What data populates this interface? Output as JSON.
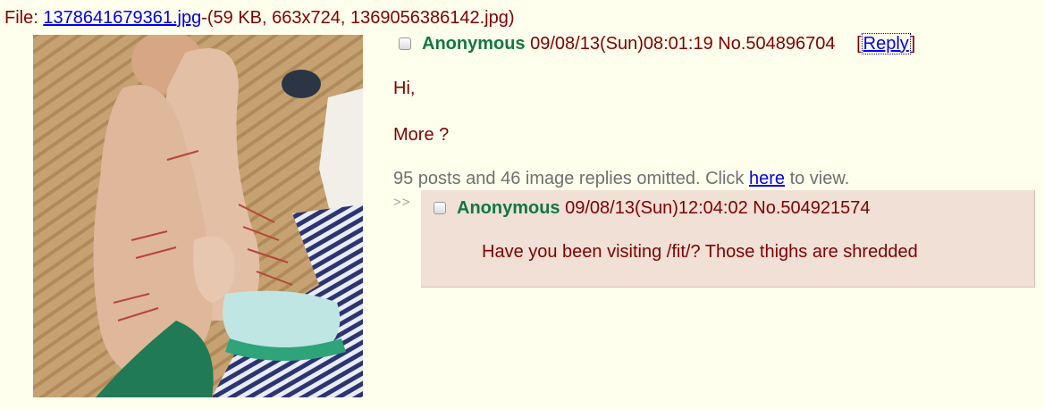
{
  "file": {
    "prefix": "File: ",
    "link": "1378641679361.jpg",
    "meta": "-(59 KB, 663x724, 1369056386142.jpg)"
  },
  "op": {
    "name": "Anonymous",
    "datetime": "09/08/13(Sun)08:01:19",
    "number": "No.504896704",
    "reply_open": "[",
    "reply_label": "Reply",
    "reply_close": "]",
    "message_lines": [
      "Hi,",
      "More ?"
    ]
  },
  "omitted": {
    "before": "95 posts and 46 image replies omitted. Click ",
    "link": "here",
    "after": " to view."
  },
  "reply": {
    "arrows": ">>",
    "name": "Anonymous",
    "datetime": "09/08/13(Sun)12:04:02",
    "number": "No.504921574",
    "message": "Have you been visiting /fit/? Those thighs are shredded"
  },
  "colors": {
    "background": "#ffffee",
    "text": "#800000",
    "name": "#117743",
    "link": "#0000ee",
    "reply_bg": "#f0e0d6"
  }
}
